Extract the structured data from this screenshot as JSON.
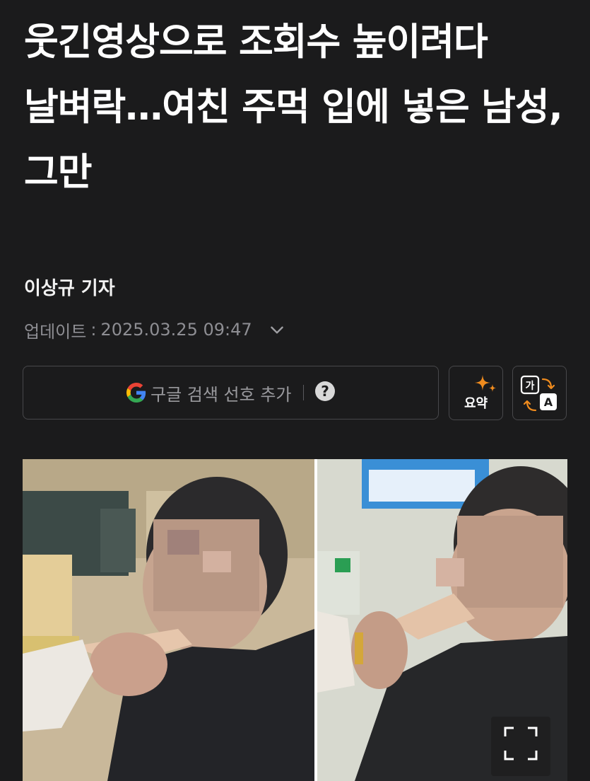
{
  "article": {
    "headline": "웃긴영상으로 조회수 높이려다 날벼락…여친 주먹 입에 넣은 남성, 그만",
    "byline": "이상규 기자",
    "updated_label": "업데이트",
    "updated_separator": ":",
    "updated_time": "2025.03.25 09:47"
  },
  "toolbar": {
    "google_pref_label": "구글 검색 선호 추가",
    "help_glyph": "?",
    "summary_label": "요약",
    "translate_icon": "translate-ga-a-icon"
  },
  "colors": {
    "background": "#1b1b1c",
    "border": "#48484b",
    "muted_text": "#8e8e93",
    "accent_orange": "#f08c1e"
  }
}
